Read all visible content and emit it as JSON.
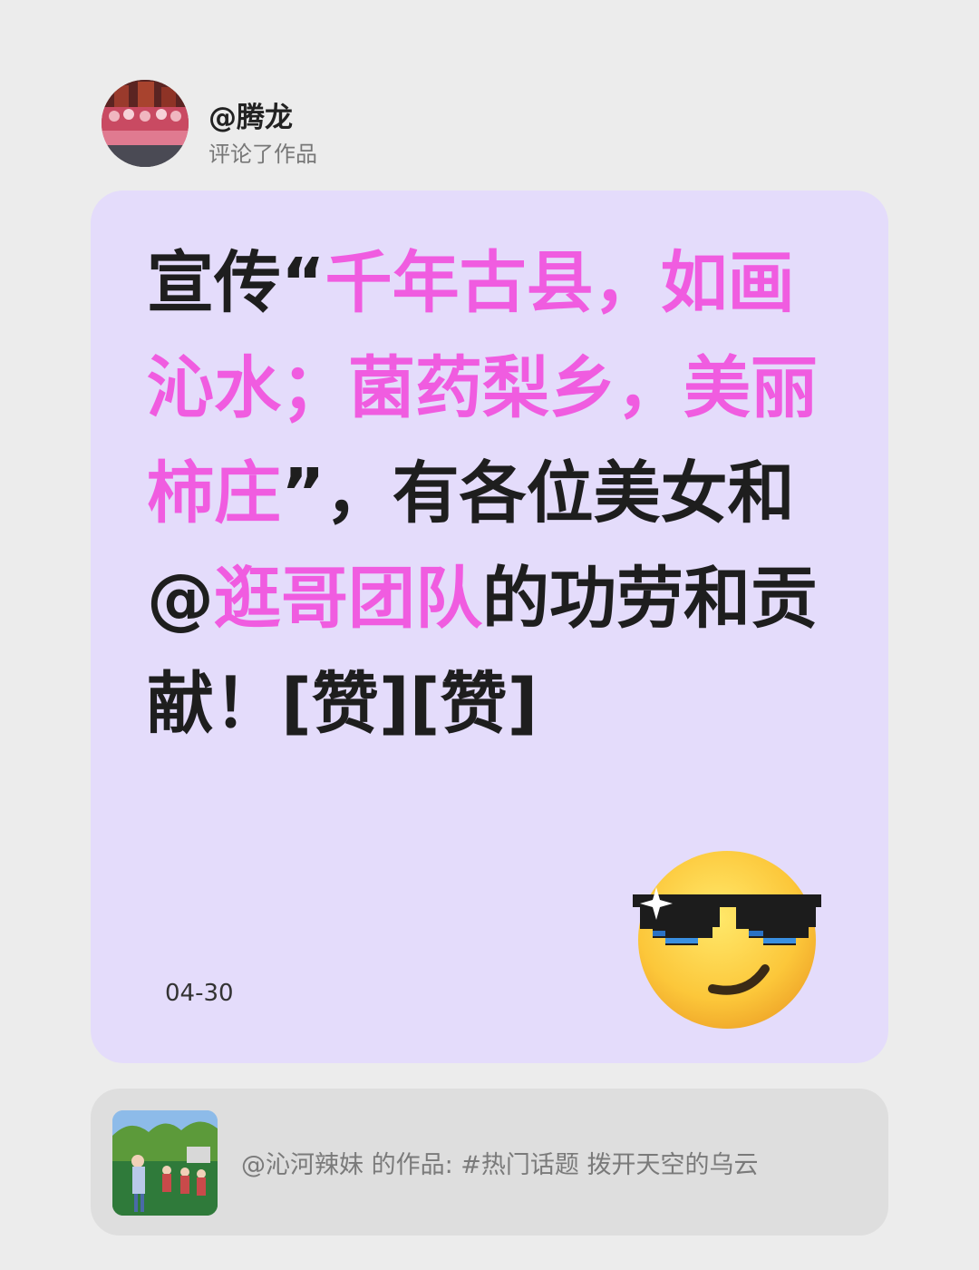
{
  "header": {
    "username": "@腾龙",
    "action": "评论了作品"
  },
  "comment": {
    "segments": [
      {
        "text": "宣传“",
        "highlight": false
      },
      {
        "text": "千年古县，如画沁水；菌药梨乡，美丽柿庄",
        "highlight": true
      },
      {
        "text": "”，有各位美女和@",
        "highlight": false
      },
      {
        "text": "逛哥团队",
        "highlight": true
      },
      {
        "text": "的功劳和贡献！[赞][赞]",
        "highlight": false
      }
    ],
    "date": "04-30",
    "sticker": "cool-sunglasses-emoji"
  },
  "reference": {
    "text": "@沁河辣妹 的作品: #热门话题 拨开天空的乌云"
  },
  "colors": {
    "page_background": "#ececec",
    "card_background": "#e4dcfb",
    "highlight": "#f05ce0",
    "text": "#1e1e1e",
    "reference_background": "#dedede",
    "reference_text": "#7a7a7a"
  }
}
